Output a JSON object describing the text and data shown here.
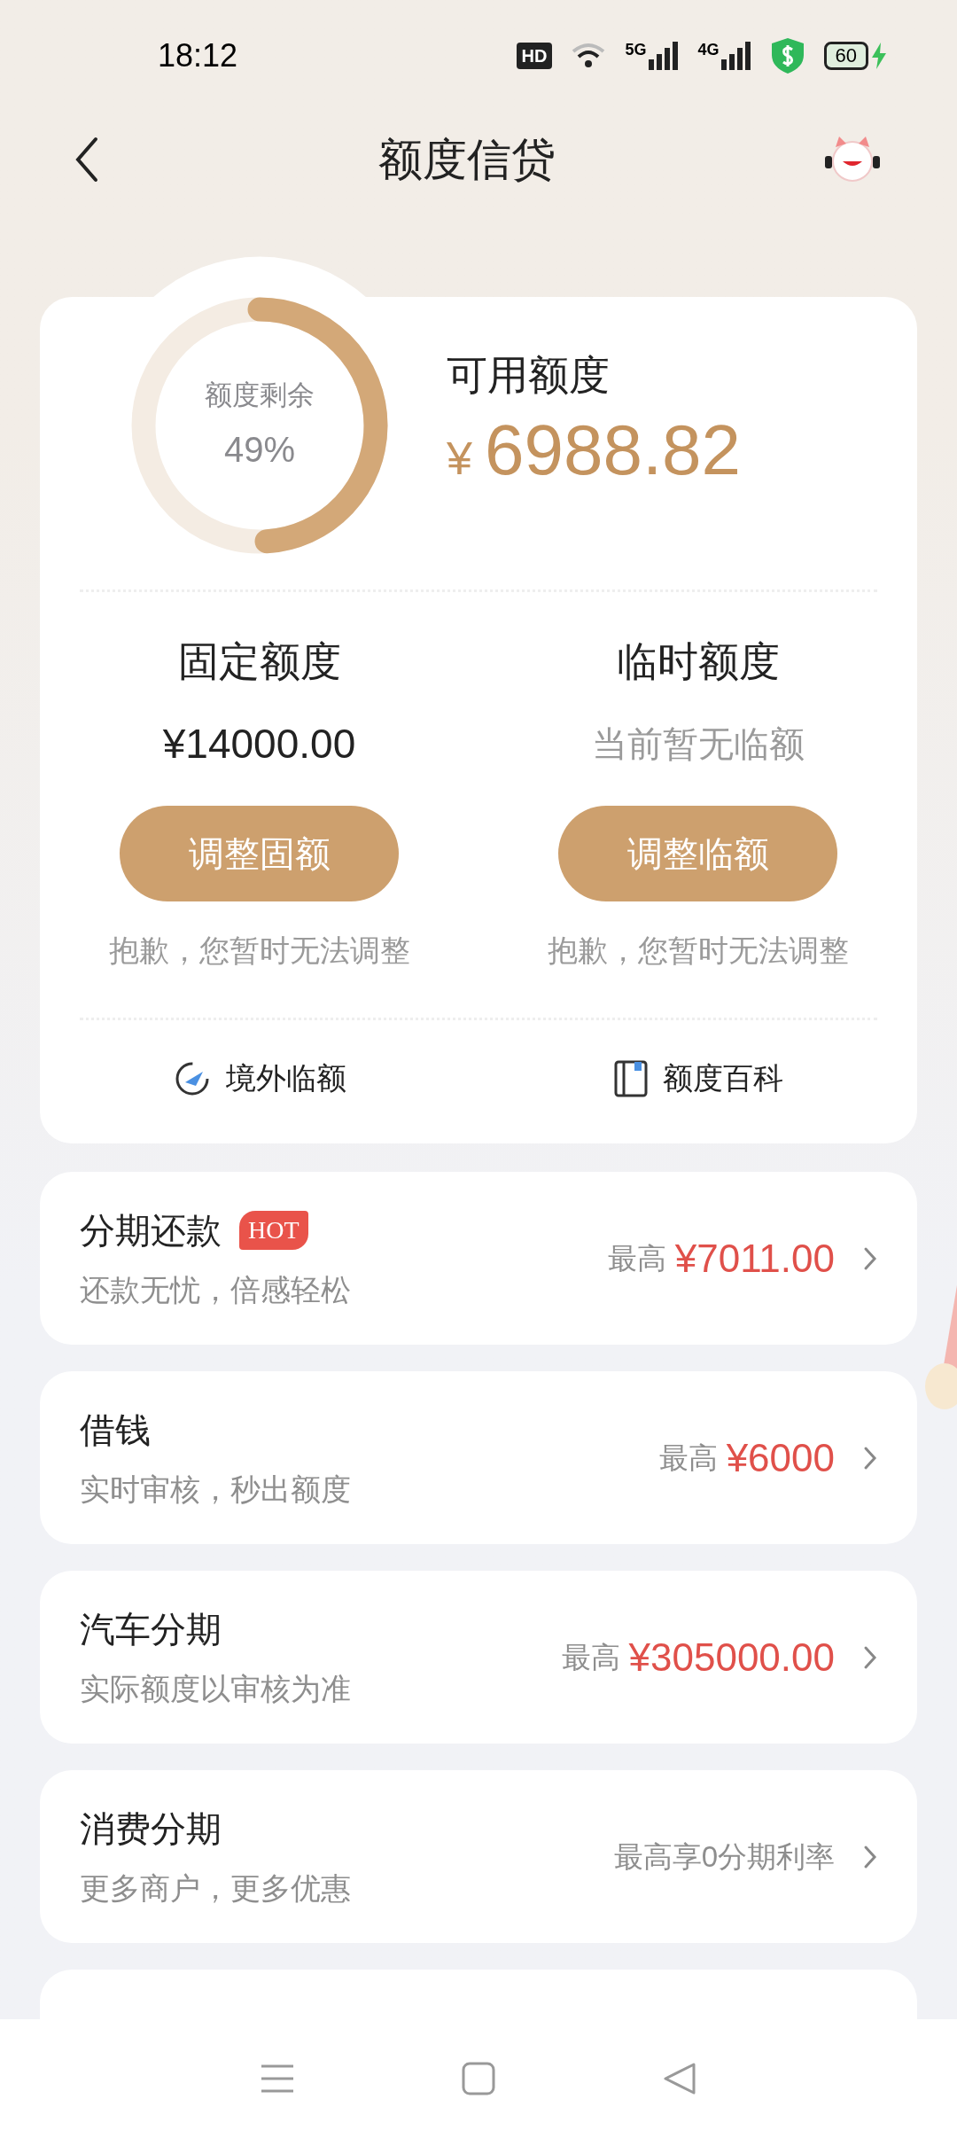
{
  "status_bar": {
    "time": "18:12",
    "network_5g": "5G",
    "network_4g": "4G",
    "battery": "60",
    "hd": "HD"
  },
  "header": {
    "title": "额度信贷"
  },
  "quota": {
    "ring_label": "额度剩余",
    "ring_percent": "49%",
    "level": 0.49,
    "available_label": "可用额度",
    "currency": "¥",
    "available_amount": "6988.82"
  },
  "limits": [
    {
      "title": "固定额度",
      "value": "¥14000.00",
      "kind": "amount",
      "button": "调整固额",
      "note": "抱歉，您暂时无法调整"
    },
    {
      "title": "临时额度",
      "value": "当前暂无临额",
      "kind": "empty",
      "button": "调整临额",
      "note": "抱歉，您暂时无法调整"
    }
  ],
  "links": [
    {
      "kind": "plane",
      "label": "境外临额"
    },
    {
      "kind": "book",
      "label": "额度百科"
    }
  ],
  "products": [
    {
      "title": "分期还款",
      "badge": "HOT",
      "subtitle": "还款无忧，倍感轻松",
      "prefix": "最高",
      "amount": "¥7011.00"
    },
    {
      "title": "借钱",
      "subtitle": "实时审核，秒出额度",
      "prefix": "最高",
      "amount": "¥6000"
    },
    {
      "title": "汽车分期",
      "subtitle": "实际额度以审核为准",
      "prefix": "最高",
      "amount": "¥305000.00"
    },
    {
      "title": "消费分期",
      "subtitle": "更多商户，更多优惠",
      "prefix": "最高享0分期利率"
    }
  ]
}
